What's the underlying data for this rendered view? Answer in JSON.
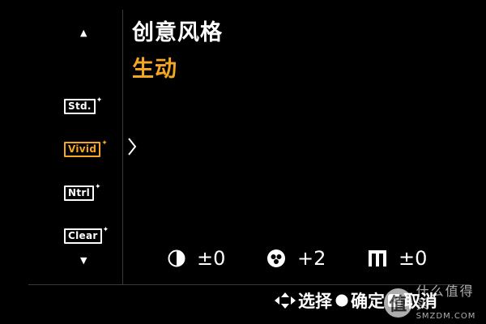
{
  "menu": {
    "title": "创意风格",
    "selected_name": "生动",
    "scroll_up": "▲",
    "scroll_down": "▼",
    "styles": [
      {
        "label": "Std.",
        "spark": "✦",
        "selected": false
      },
      {
        "label": "Vivid",
        "spark": "✦",
        "selected": true
      },
      {
        "label": "Ntrl",
        "spark": "✦",
        "selected": false
      },
      {
        "label": "Clear",
        "spark": "✦",
        "selected": false
      }
    ]
  },
  "params": [
    {
      "icon": "contrast-icon",
      "value": "±0"
    },
    {
      "icon": "saturation-icon",
      "value": "+2"
    },
    {
      "icon": "sharpness-icon",
      "value": "±0"
    }
  ],
  "footer": {
    "select_label": "选择",
    "confirm_label": "确定",
    "cancel_label": "取消"
  },
  "watermark": {
    "logo_char": "值",
    "cn": "什么值得买",
    "en": "SMZDM.COM"
  },
  "colors": {
    "accent": "#f5a623",
    "background": "#000000",
    "text": "#ffffff"
  }
}
